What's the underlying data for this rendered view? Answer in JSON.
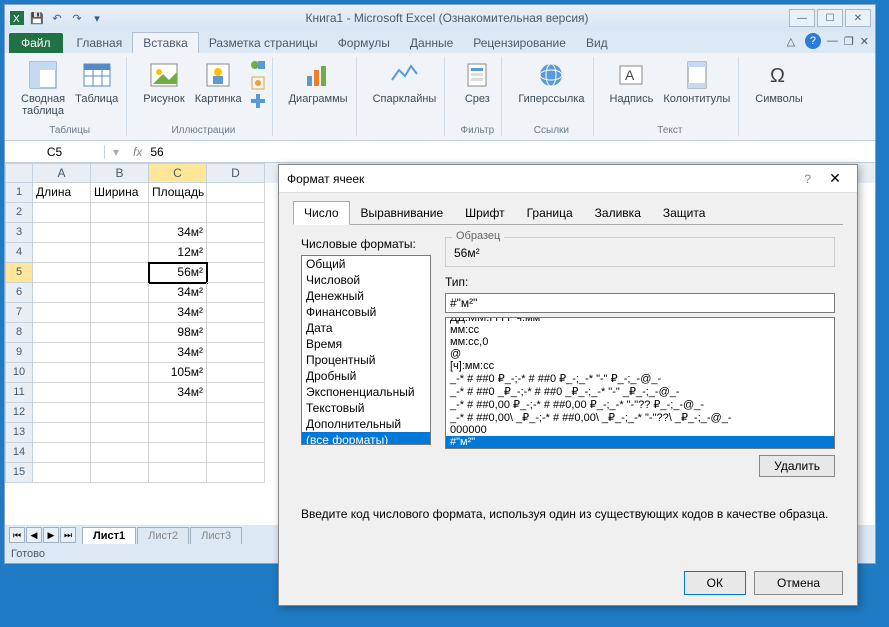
{
  "titlebar": {
    "title": "Книга1 - Microsoft Excel (Ознакомительная версия)"
  },
  "tabs": {
    "file": "Файл",
    "items": [
      "Главная",
      "Вставка",
      "Разметка страницы",
      "Формулы",
      "Данные",
      "Рецензирование",
      "Вид"
    ],
    "active": 1
  },
  "ribbon": {
    "groups": [
      {
        "label": "Таблицы",
        "buttons": [
          "Сводная\nтаблица",
          "Таблица"
        ]
      },
      {
        "label": "Иллюстрации",
        "buttons": [
          "Рисунок",
          "Картинка"
        ]
      },
      {
        "label": "",
        "buttons": [
          "Диаграммы"
        ]
      },
      {
        "label": "",
        "buttons": [
          "Спарклайны"
        ]
      },
      {
        "label": "Фильтр",
        "buttons": [
          "Срез"
        ]
      },
      {
        "label": "Ссылки",
        "buttons": [
          "Гиперссылка"
        ]
      },
      {
        "label": "Текст",
        "buttons": [
          "Надпись",
          "Колонтитулы"
        ]
      },
      {
        "label": "",
        "buttons": [
          "Символы"
        ]
      }
    ]
  },
  "formula_bar": {
    "name_box": "C5",
    "fx": "fx",
    "value": "56"
  },
  "grid": {
    "columns": [
      "A",
      "B",
      "C",
      "D"
    ],
    "active_col": 2,
    "active_row": 5,
    "rows": [
      {
        "n": 1,
        "cells": [
          "Длина",
          "Ширина",
          "Площадь",
          ""
        ]
      },
      {
        "n": 2,
        "cells": [
          "",
          "",
          "",
          ""
        ]
      },
      {
        "n": 3,
        "cells": [
          "",
          "",
          "34м²",
          ""
        ]
      },
      {
        "n": 4,
        "cells": [
          "",
          "",
          "12м²",
          ""
        ]
      },
      {
        "n": 5,
        "cells": [
          "",
          "",
          "56м²",
          ""
        ]
      },
      {
        "n": 6,
        "cells": [
          "",
          "",
          "34м²",
          ""
        ]
      },
      {
        "n": 7,
        "cells": [
          "",
          "",
          "34м²",
          ""
        ]
      },
      {
        "n": 8,
        "cells": [
          "",
          "",
          "98м²",
          ""
        ]
      },
      {
        "n": 9,
        "cells": [
          "",
          "",
          "34м²",
          ""
        ]
      },
      {
        "n": 10,
        "cells": [
          "",
          "",
          "105м²",
          ""
        ]
      },
      {
        "n": 11,
        "cells": [
          "",
          "",
          "34м²",
          ""
        ]
      },
      {
        "n": 12,
        "cells": [
          "",
          "",
          "",
          ""
        ]
      },
      {
        "n": 13,
        "cells": [
          "",
          "",
          "",
          ""
        ]
      },
      {
        "n": 14,
        "cells": [
          "",
          "",
          "",
          ""
        ]
      },
      {
        "n": 15,
        "cells": [
          "",
          "",
          "",
          ""
        ]
      }
    ]
  },
  "sheets": {
    "items": [
      "Лист1",
      "Лист2",
      "Лист3"
    ],
    "active": 0
  },
  "status": "Готово",
  "dialog": {
    "title": "Формат ячеек",
    "tabs": [
      "Число",
      "Выравнивание",
      "Шрифт",
      "Граница",
      "Заливка",
      "Защита"
    ],
    "active_tab": 0,
    "category_label": "Числовые форматы:",
    "categories": [
      "Общий",
      "Числовой",
      "Денежный",
      "Финансовый",
      "Дата",
      "Время",
      "Процентный",
      "Дробный",
      "Экспоненциальный",
      "Текстовый",
      "Дополнительный",
      "(все форматы)"
    ],
    "selected_category": 11,
    "sample_label": "Образец",
    "sample_value": "56м²",
    "type_label": "Тип:",
    "type_value": "#\"м²\"",
    "type_list": [
      "ДД.ММ.ГГГГ ч:мм",
      "мм:сс",
      "мм:сс,0",
      "@",
      "[ч]:мм:сс",
      "_-* # ##0 ₽_-;-* # ##0 ₽_-;_-* \"-\" ₽_-;_-@_-",
      "_-* # ##0 _₽_-;-* # ##0 _₽_-;_-* \"-\" _₽_-;_-@_-",
      "_-* # ##0,00 ₽_-;-* # ##0,00 ₽_-;_-* \"-\"?? ₽_-;_-@_-",
      "_-* # ##0,00\\ _₽_-;-* # ##0,00\\ _₽_-;_-* \"-\"??\\ _₽_-;_-@_-",
      "000000",
      "#\"м²\""
    ],
    "selected_type": 10,
    "delete_btn": "Удалить",
    "hint": "Введите код числового формата, используя один из существующих кодов в качестве образца.",
    "ok": "ОК",
    "cancel": "Отмена"
  }
}
